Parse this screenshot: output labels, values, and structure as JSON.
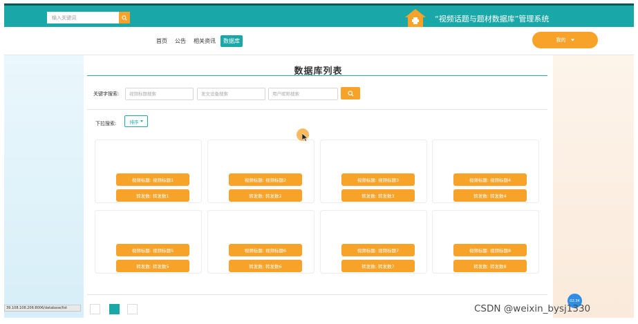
{
  "topbar": {
    "search_placeholder": "输入关键词",
    "title": "“视频话题与题材数据库”管理系统"
  },
  "nav": {
    "items": [
      "首页",
      "公告",
      "相关资讯",
      "数据库"
    ],
    "active_index": 3,
    "user_label": "我的"
  },
  "main": {
    "title": "数据库列表",
    "keyword_label": "关键字搜索:",
    "keyword_inputs": [
      "视频标题搜索",
      "发文设备搜索",
      "用户昵称搜索"
    ],
    "dropdown_label": "下拉搜索:",
    "sort_label": "排序",
    "cards": [
      {
        "line1": "视频标题: 视频标题1",
        "line2": "转发数: 转发数1"
      },
      {
        "line1": "视频标题: 视频标题2",
        "line2": "转发数: 转发数2"
      },
      {
        "line1": "视频标题: 视频标题3",
        "line2": "转发数: 转发数3"
      },
      {
        "line1": "视频标题: 视频标题4",
        "line2": "转发数: 转发数4"
      },
      {
        "line1": "视频标题: 视频标题5",
        "line2": "转发数: 转发数5"
      },
      {
        "line1": "视频标题: 视频标题6",
        "line2": "转发数: 转发数6"
      },
      {
        "line1": "视频标题: 视频标题7",
        "line2": "转发数: 转发数7"
      },
      {
        "line1": "视频标题: 视频标题8",
        "line2": "转发数: 转发数8"
      }
    ]
  },
  "overlay": {
    "status_url": "39.108.108.206:8006/database/list",
    "timer": "02:34",
    "watermark": "CSDN @weixin_bysj1330"
  },
  "colors": {
    "teal": "#1aa7a7",
    "orange": "#f7a32a"
  },
  "icons": [
    "search-icon",
    "home-icon",
    "caret-down-icon",
    "cursor-icon"
  ]
}
